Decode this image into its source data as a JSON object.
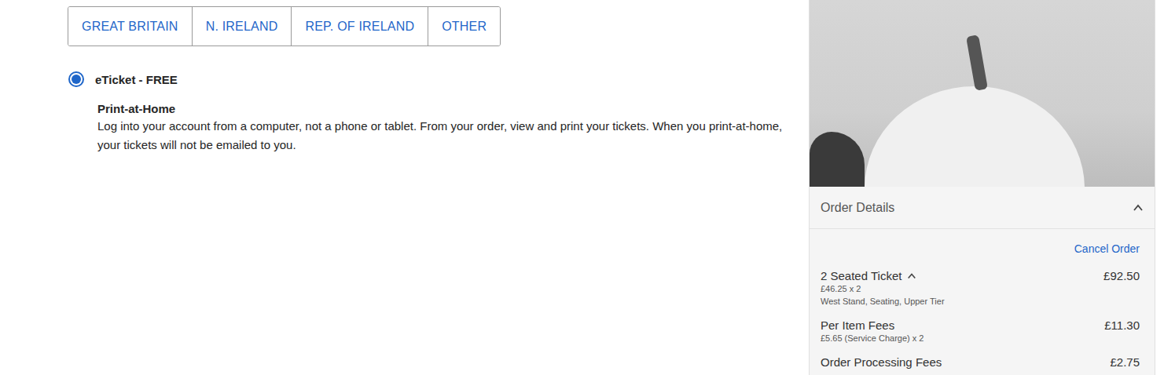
{
  "delivery_regions": [
    {
      "label": "GREAT BRITAIN",
      "selected": false
    },
    {
      "label": "N. IRELAND",
      "selected": false
    },
    {
      "label": "REP. OF IRELAND",
      "selected": false
    },
    {
      "label": "OTHER",
      "selected": false
    }
  ],
  "delivery_options": [
    {
      "label": "eTicket - FREE",
      "selected": true,
      "title": "Print-at-Home",
      "description": "Log into your account from a computer, not a phone or tablet. From your order, view and print your tickets. When you print-at-home, your tickets will not be emailed to you."
    }
  ],
  "order": {
    "header": "Order Details",
    "expanded": true,
    "cancel": "Cancel Order",
    "items": [
      {
        "name": "2 Seated Ticket",
        "has_toggle": true,
        "expanded": true,
        "price": "£92.50",
        "details": [
          "£46.25 x 2",
          "West Stand, Seating, Upper Tier"
        ]
      },
      {
        "name": "Per Item Fees",
        "has_toggle": false,
        "expanded": false,
        "price": "£11.30",
        "details": [
          "£5.65 (Service Charge) x 2"
        ]
      },
      {
        "name": "Order Processing Fees",
        "has_toggle": false,
        "expanded": false,
        "price": "£2.75",
        "details": []
      }
    ]
  }
}
